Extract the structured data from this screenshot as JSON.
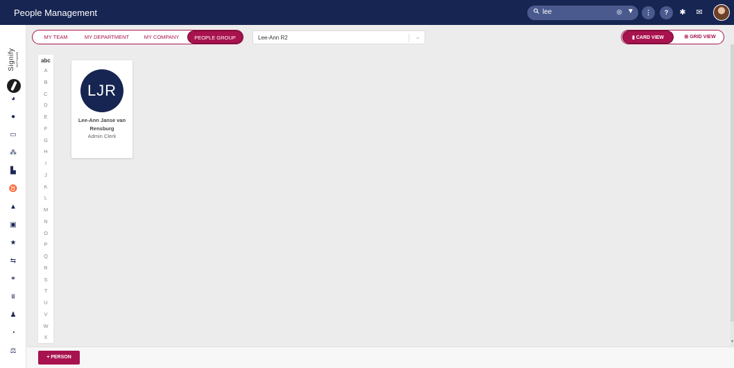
{
  "app": {
    "title": "People Management"
  },
  "search": {
    "value": "lee",
    "icon": "search-icon",
    "clear_icon": "clear-icon",
    "filter_icon": "filter-icon"
  },
  "header_icons": [
    "more-icon",
    "help-icon",
    "gear-icon",
    "mail-icon",
    "avatar"
  ],
  "header_labels": {
    "more": "⋮",
    "help": "?"
  },
  "brand": {
    "name": "Signify",
    "tagline": "SOFTWARE"
  },
  "tabs": [
    {
      "label": "My Team",
      "active": false
    },
    {
      "label": "My Department",
      "active": false
    },
    {
      "label": "My Company",
      "active": false
    },
    {
      "label": "People Group",
      "active": true
    }
  ],
  "group_select": {
    "value": "Lee-Ann R2"
  },
  "views": [
    {
      "label": "Card View",
      "icon": "document-icon",
      "active": true
    },
    {
      "label": "Grid View",
      "icon": "grid-icon",
      "active": false
    }
  ],
  "alphabet": {
    "header": "abc",
    "letters": [
      "A",
      "B",
      "C",
      "D",
      "E",
      "F",
      "G",
      "H",
      "I",
      "J",
      "K",
      "L",
      "M",
      "N",
      "O",
      "P",
      "Q",
      "R",
      "S",
      "T",
      "U",
      "V",
      "W",
      "X"
    ]
  },
  "person": {
    "initials": "LJR",
    "name": "Lee-Ann Janse van Rensburg",
    "role": "Admin Clerk"
  },
  "add_button": {
    "label": "+ Person"
  },
  "colors": {
    "navy": "#172552",
    "accent": "#a8134f",
    "background": "#ececec"
  }
}
